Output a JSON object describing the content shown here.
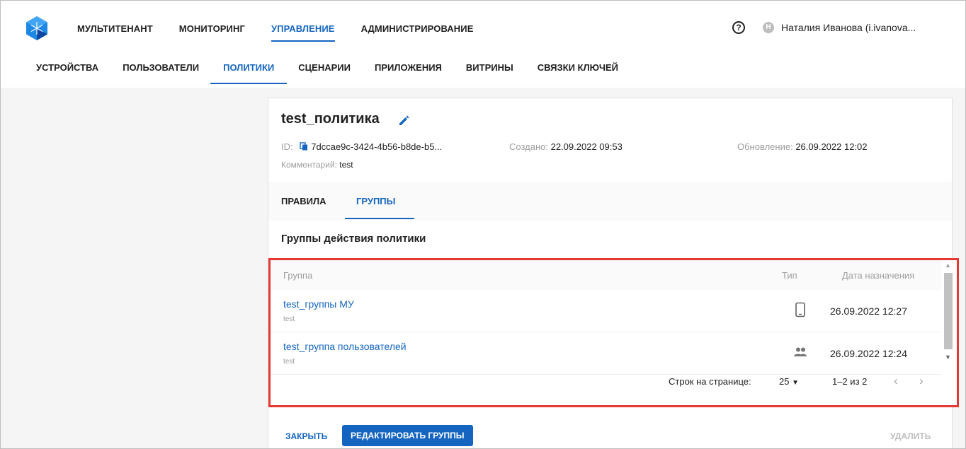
{
  "topnav": {
    "items": [
      {
        "label": "МУЛЬТИТЕНАНТ",
        "active": false
      },
      {
        "label": "МОНИТОРИНГ",
        "active": false
      },
      {
        "label": "УПРАВЛЕНИЕ",
        "active": true
      },
      {
        "label": "АДМИНИСТРИРОВАНИЕ",
        "active": false
      }
    ],
    "help_icon": "help-circle-icon",
    "user_initial": "Н",
    "user_name": "Наталия Иванова (i.ivanova..."
  },
  "subnav": {
    "items": [
      {
        "label": "УСТРОЙСТВА"
      },
      {
        "label": "ПОЛЬЗОВАТЕЛИ"
      },
      {
        "label": "ПОЛИТИКИ",
        "active": true
      },
      {
        "label": "СЦЕНАРИИ"
      },
      {
        "label": "ПРИЛОЖЕНИЯ"
      },
      {
        "label": "ВИТРИНЫ"
      },
      {
        "label": "СВЯЗКИ КЛЮЧЕЙ"
      }
    ]
  },
  "policy": {
    "title": "test_политика",
    "id_label": "ID:",
    "id_value": "7dccae9c-3424-4b56-b8de-b5...",
    "created_label": "Создано:",
    "created_value": "22.09.2022 09:53",
    "updated_label": "Обновление:",
    "updated_value": "26.09.2022 12:02",
    "comment_label": "Комментарий:",
    "comment_value": "test"
  },
  "tabs": [
    {
      "label": "ПРАВИЛА",
      "active": false
    },
    {
      "label": "ГРУППЫ",
      "active": true
    }
  ],
  "groups_section": {
    "title": "Группы действия политики",
    "columns": {
      "group": "Группа",
      "type": "Тип",
      "date": "Дата назначения"
    },
    "rows": [
      {
        "name": "test_группы МУ",
        "sub": "test",
        "type_icon": "mobile-device-icon",
        "date": "26.09.2022 12:27"
      },
      {
        "name": "test_группа пользователей",
        "sub": "test",
        "type_icon": "users-group-icon",
        "date": "26.09.2022 12:24"
      }
    ],
    "pager": {
      "rows_label": "Строк на странице:",
      "rows_value": "25",
      "range": "1–2 из 2"
    }
  },
  "actions": {
    "close": "ЗАКРЫТЬ",
    "edit_groups": "РЕДАКТИРОВАТЬ ГРУППЫ",
    "delete": "УДАЛИТЬ"
  },
  "colors": {
    "accent": "#1565c0",
    "highlight_border": "#e53935"
  }
}
